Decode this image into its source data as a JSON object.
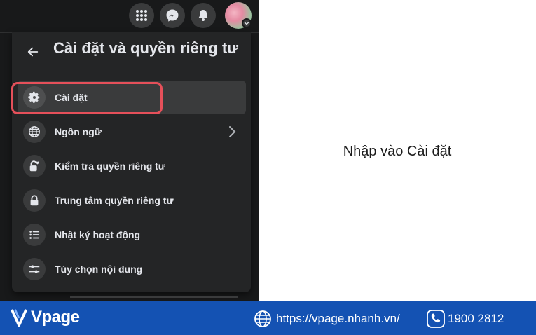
{
  "panel": {
    "title": "Cài đặt và quyền riêng tư",
    "items": [
      {
        "label": "Cài đặt",
        "icon": "gear-icon",
        "active": true
      },
      {
        "label": "Ngôn ngữ",
        "icon": "globe-icon",
        "has_arrow": true
      },
      {
        "label": "Kiểm tra quyền riêng tư",
        "icon": "lock-heart-icon"
      },
      {
        "label": "Trung tâm quyền riêng tư",
        "icon": "lock-icon"
      },
      {
        "label": "Nhật ký hoạt động",
        "icon": "list-icon"
      },
      {
        "label": "Tùy chọn nội dung",
        "icon": "sliders-icon"
      }
    ]
  },
  "topbar": {
    "icons": [
      "menu-grid-icon",
      "messenger-icon",
      "bell-icon",
      "avatar"
    ]
  },
  "caption": "Nhập vào Cài đặt",
  "footer": {
    "brand": "Vpage",
    "website": "https://vpage.nhanh.vn/",
    "phone": "1900 2812"
  },
  "colors": {
    "dark_bg": "#18191a",
    "panel_bg": "#242526",
    "highlight": "#e5505a",
    "footer_bg": "#1452b3"
  }
}
